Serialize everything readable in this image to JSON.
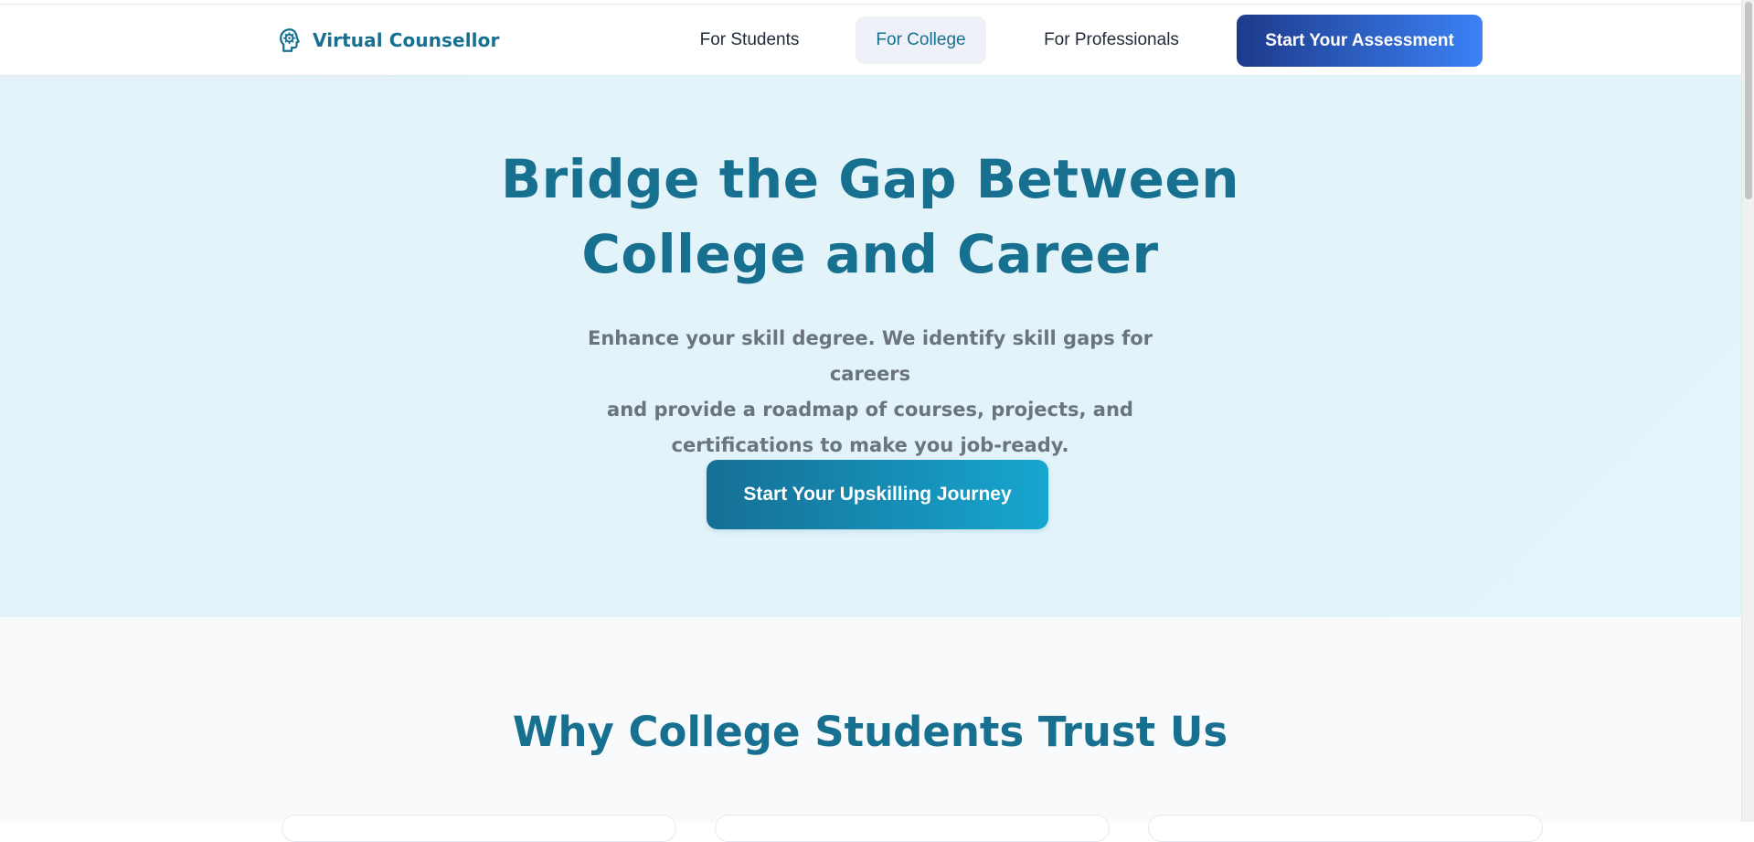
{
  "brand": {
    "name": "Virtual Counsellor",
    "icon": "head-gear-icon",
    "color": "#17708f"
  },
  "nav": {
    "items": [
      {
        "label": "For Students",
        "active": false
      },
      {
        "label": "For College",
        "active": true
      },
      {
        "label": "For Professionals",
        "active": false
      }
    ],
    "cta_label": "Start Your Assessment"
  },
  "hero": {
    "title_line1": "Bridge the Gap Between",
    "title_line2": "College and Career",
    "subtitle_line1": "Enhance your skill degree. We identify skill gaps for careers",
    "subtitle_line2": "and provide a roadmap of courses, projects, and",
    "subtitle_line3": "certifications to make you job-ready.",
    "cta_label": "Start Your Upskilling Journey"
  },
  "trust": {
    "title": "Why College Students Trust Us"
  },
  "colors": {
    "primary": "#17708f",
    "nav_cta_start": "#1e3a8a",
    "nav_cta_end": "#3b82f6",
    "hero_cta_start": "#166f95",
    "hero_cta_end": "#17a6cf",
    "hero_bg": "#e2f4fa",
    "active_nav_bg": "#eef1f7",
    "subtitle_text": "#6b7280"
  }
}
